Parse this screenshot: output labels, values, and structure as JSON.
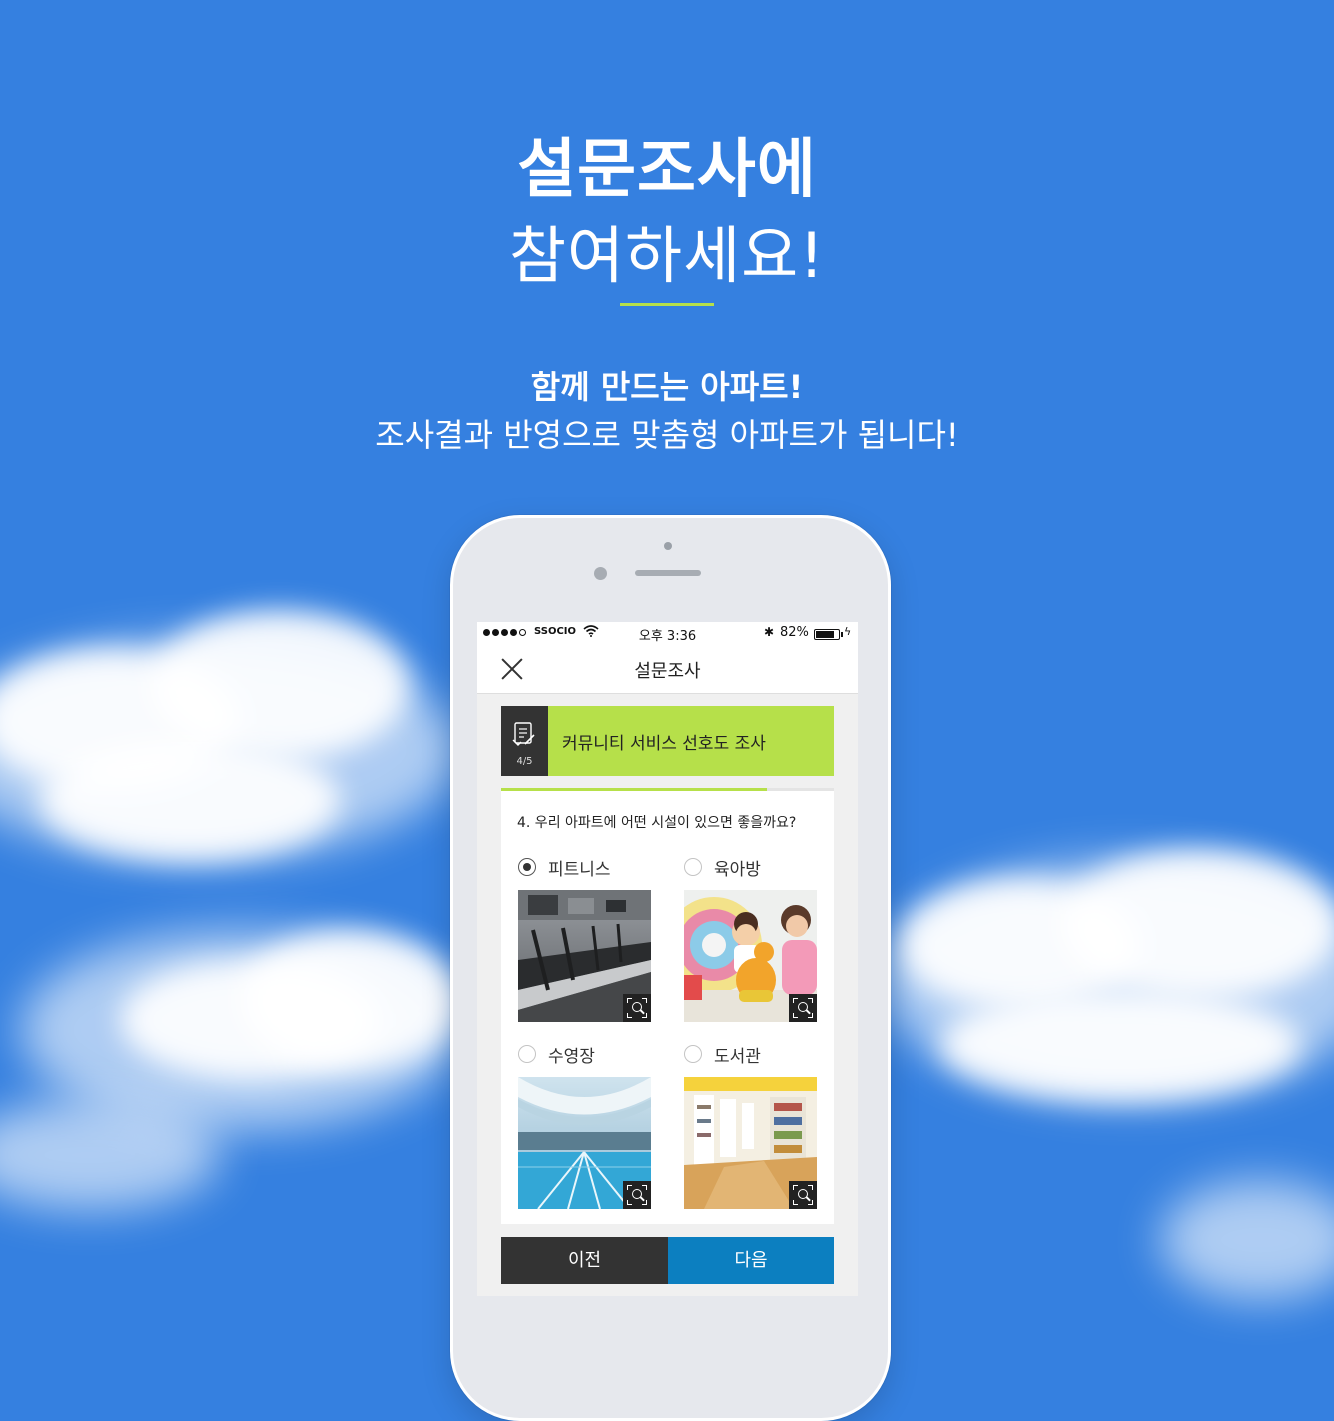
{
  "hero": {
    "title_line1": "설문조사에",
    "title_line2": "참여하세요!",
    "subtitle_line1": "함께 만드는 아파트!",
    "subtitle_line2": "조사결과 반영으로 맞춤형 아파트가 됩니다!"
  },
  "colors": {
    "background": "#3580e0",
    "accent_green": "#b6e04a",
    "dark": "#333333",
    "next_blue": "#0c7fc0"
  },
  "statusbar": {
    "carrier": "SSOCIO",
    "time": "오후 3:36",
    "battery": "82%",
    "icons": [
      "signal-icon",
      "wifi-icon",
      "bluetooth-icon",
      "battery-icon",
      "charging-icon"
    ]
  },
  "navbar": {
    "title": "설문조사",
    "close_icon": "close-icon"
  },
  "survey": {
    "title": "커뮤니티 서비스 선호도 조사",
    "progress_label": "4/5",
    "progress_fraction": 0.8,
    "question": "4. 우리 아파트에 어떤 시설이 있으면 좋을까요?",
    "options": [
      {
        "label": "피트니스",
        "selected": true,
        "image": "treadmill-gym-photo"
      },
      {
        "label": "육아방",
        "selected": false,
        "image": "kids-playroom-photo"
      },
      {
        "label": "수영장",
        "selected": false,
        "image": "indoor-pool-photo"
      },
      {
        "label": "도서관",
        "selected": false,
        "image": "library-shelves-photo"
      }
    ]
  },
  "buttons": {
    "prev": "이전",
    "next": "다음"
  }
}
